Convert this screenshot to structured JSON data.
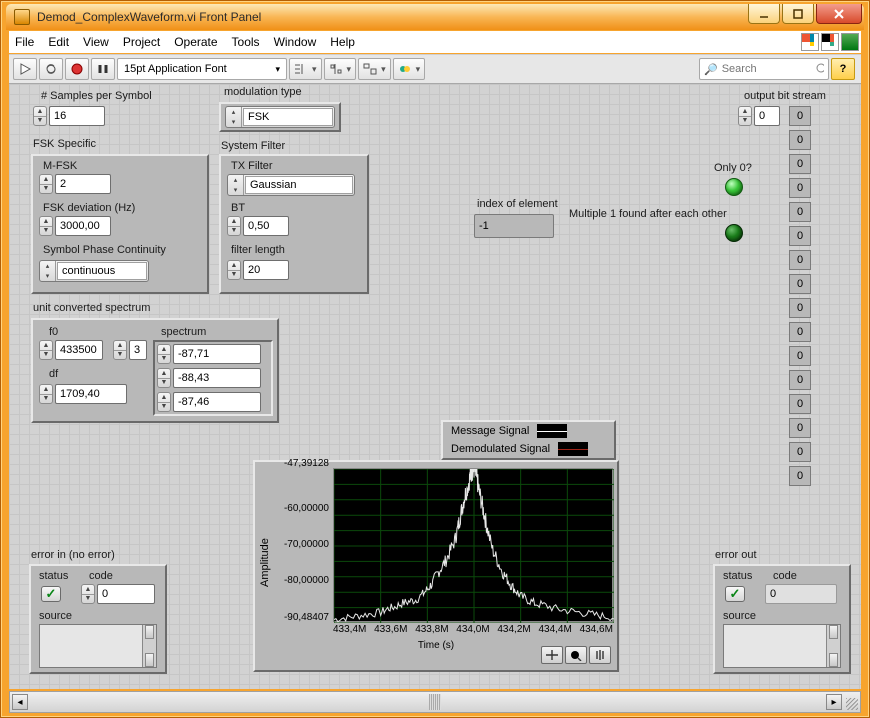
{
  "window": {
    "title": "Demod_ComplexWaveform.vi Front Panel"
  },
  "menu": {
    "file": "File",
    "edit": "Edit",
    "view": "View",
    "project": "Project",
    "operate": "Operate",
    "tools": "Tools",
    "window": "Window",
    "help": "Help"
  },
  "toolbar": {
    "font": "15pt Application Font",
    "search_placeholder": "Search",
    "help": "?"
  },
  "controls": {
    "samples_label": "# Samples per Symbol",
    "samples": "16",
    "modtype_label": "modulation type",
    "modtype": "FSK",
    "fsk_section": "FSK Specific",
    "mfsk_label": "M-FSK",
    "mfsk": "2",
    "fskdev_label": "FSK deviation (Hz)",
    "fskdev": "3000,00",
    "phasecont_label": "Symbol Phase Continuity",
    "phasecont": "continuous",
    "sysfilter_label": "System Filter",
    "txfilter_label": "TX Filter",
    "txfilter": "Gaussian",
    "bt_label": "BT",
    "bt": "0,50",
    "flen_label": "filter length",
    "flen": "20",
    "spec_label": "unit converted spectrum",
    "f0_label": "f0",
    "f0": "433500",
    "specidx": "3",
    "spectrum_label": "spectrum",
    "spec0": "-87,71",
    "spec1": "-88,43",
    "spec2": "-87,46",
    "df_label": "df",
    "df": "1709,40",
    "index_label": "index of element",
    "index": "-1",
    "only0_label": "Only 0?",
    "mult1_label": "Multiple 1 found after each other",
    "outbit_label": "output bit stream",
    "outbit_idx": "0",
    "errin_label": "error in (no error)",
    "errout_label": "error out",
    "status_label": "status",
    "code_label": "code",
    "source_label": "source",
    "code_in": "0",
    "code_out": "0"
  },
  "output_bits": [
    "0",
    "0",
    "0",
    "0",
    "0",
    "0",
    "0",
    "0",
    "0",
    "0",
    "0",
    "0",
    "0",
    "0",
    "0",
    "0"
  ],
  "graph": {
    "legend": {
      "msg": "Message Signal",
      "dmod": "Demodulated Signal"
    },
    "xlabel": "Time (s)",
    "ylabel": "Amplitude"
  },
  "chart_data": {
    "type": "line",
    "title": "",
    "xlabel": "Time (s)",
    "ylabel": "Amplitude",
    "xticks": [
      "433,4M",
      "433,6M",
      "433,8M",
      "434,0M",
      "434,2M",
      "434,4M",
      "434,6M"
    ],
    "yticks": [
      "-47,39128",
      "-60,00000",
      "-70,00000",
      "-80,00000",
      "-90,48407"
    ],
    "xlim": [
      433.4,
      434.6
    ],
    "ylim": [
      -90.48407,
      -47.39128
    ],
    "series": [
      {
        "name": "Message Signal",
        "color": "#ffffff",
        "x": [
          433.4,
          433.45,
          433.5,
          433.55,
          433.6,
          433.63,
          433.66,
          433.69,
          433.72,
          433.75,
          433.78,
          433.8,
          433.82,
          433.84,
          433.86,
          433.88,
          433.9,
          433.92,
          433.93,
          433.94,
          433.95,
          433.96,
          433.97,
          433.98,
          433.985,
          433.99,
          433.995,
          434.0,
          434.005,
          434.01,
          434.015,
          434.02,
          434.03,
          434.04,
          434.05,
          434.06,
          434.08,
          434.1,
          434.12,
          434.14,
          434.16,
          434.18,
          434.2,
          434.23,
          434.26,
          434.3,
          434.35,
          434.4,
          434.45,
          434.5,
          434.55,
          434.6
        ],
        "y": [
          -89.5,
          -89.0,
          -88.5,
          -88.0,
          -87.5,
          -86.5,
          -86.0,
          -85.0,
          -84.5,
          -84.0,
          -82.5,
          -81.0,
          -79.5,
          -77.0,
          -75.0,
          -73.0,
          -70.0,
          -67.0,
          -64.0,
          -61.0,
          -58.0,
          -55.0,
          -53.0,
          -50.5,
          -49.0,
          -48.0,
          -47.5,
          -47.4,
          -48.0,
          -49.5,
          -51.0,
          -53.0,
          -56.0,
          -59.0,
          -62.0,
          -65.0,
          -70.0,
          -73.0,
          -76.0,
          -78.0,
          -80.0,
          -81.5,
          -83.0,
          -84.0,
          -85.0,
          -85.5,
          -86.5,
          -87.0,
          -87.5,
          -88.0,
          -88.5,
          -89.0
        ]
      },
      {
        "name": "Demodulated Signal",
        "color": "#a02418",
        "x": [],
        "y": []
      }
    ],
    "legend_pos": "top-right"
  }
}
